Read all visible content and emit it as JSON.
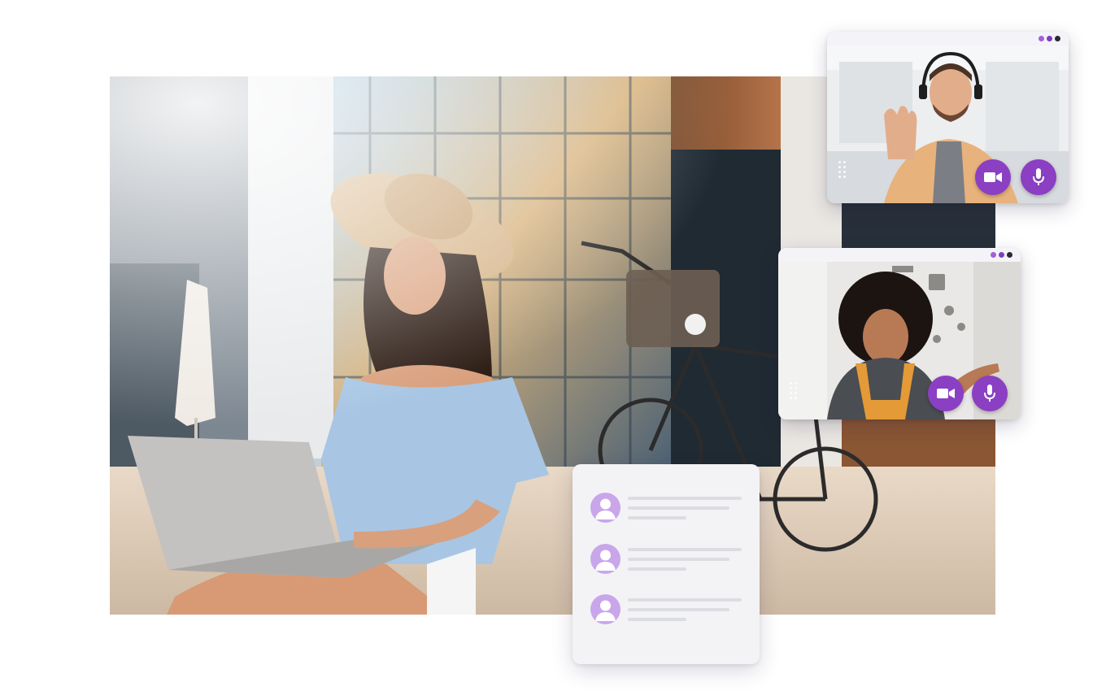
{
  "theme": {
    "accent": "#8b3fc2",
    "avatar_bg": "#c9a6ea",
    "window_dots": [
      "#a65fd8",
      "#7e3fbf",
      "#2a2a35"
    ]
  },
  "hero": {
    "subject": "woman-with-laptop-photo"
  },
  "video_calls": [
    {
      "participant": "man-with-headset",
      "controls": [
        {
          "icon": "video-camera-icon"
        },
        {
          "icon": "microphone-icon"
        }
      ]
    },
    {
      "participant": "woman-waving",
      "controls": [
        {
          "icon": "video-camera-icon"
        },
        {
          "icon": "microphone-icon"
        }
      ]
    }
  ],
  "participants_list": {
    "rows": [
      {
        "avatar": "user-avatar-icon"
      },
      {
        "avatar": "user-avatar-icon"
      },
      {
        "avatar": "user-avatar-icon"
      }
    ]
  }
}
